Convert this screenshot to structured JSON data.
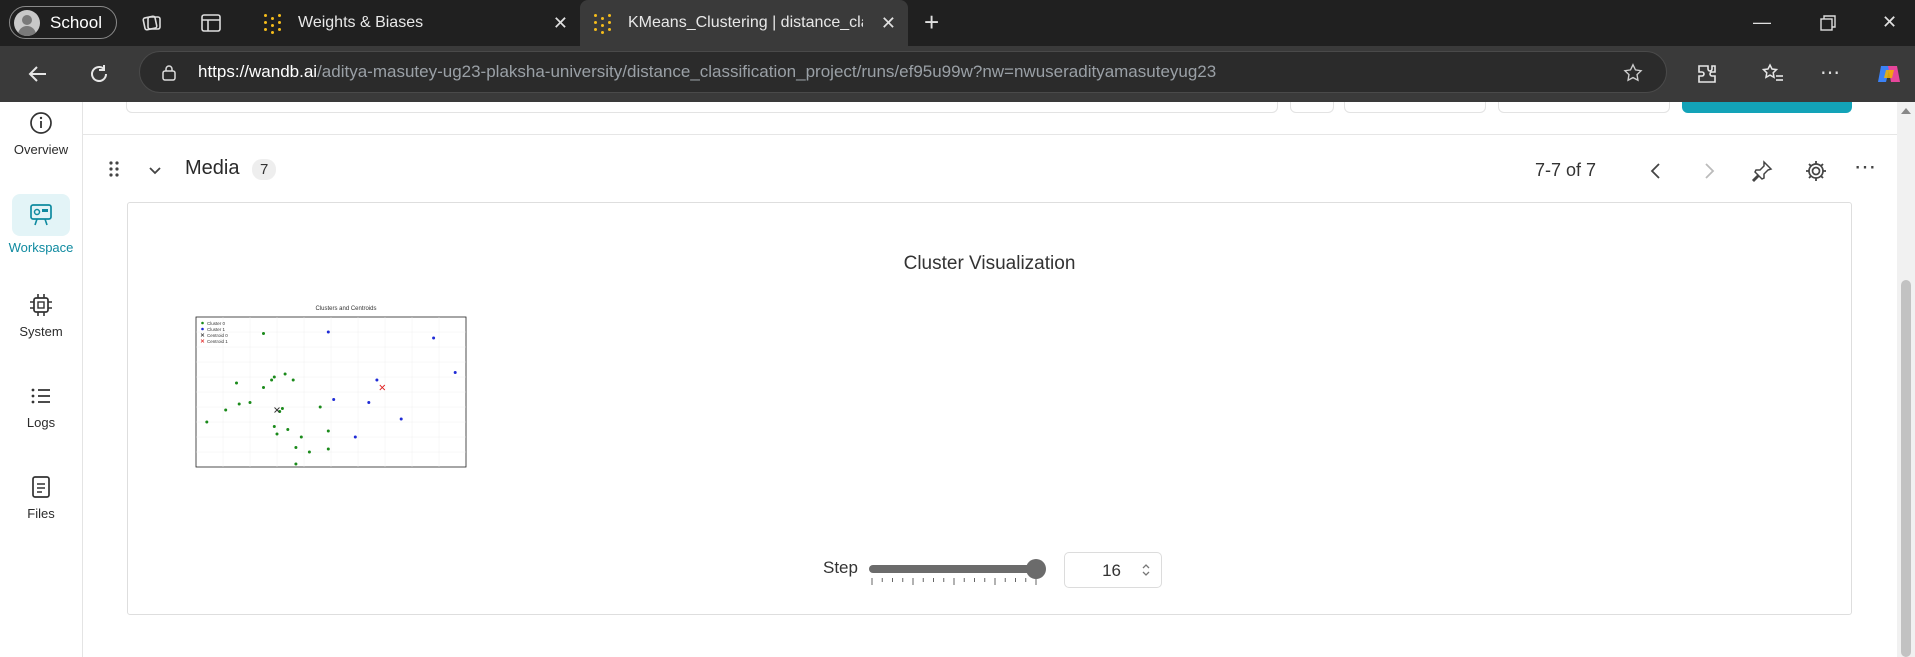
{
  "browser": {
    "profile_label": "School",
    "tabs": [
      {
        "title": "Weights & Biases",
        "active": false
      },
      {
        "title": "KMeans_Clustering | distance_clas",
        "active": true
      }
    ],
    "url_host": "https://wandb.ai",
    "url_path": "/aditya-masutey-ug23-plaksha-university/distance_classification_project/runs/ef95u99w?nw=nwuseradityamasuteyug23"
  },
  "sidebar": {
    "items": [
      {
        "label": "Overview",
        "icon": "info-icon",
        "active": false
      },
      {
        "label": "Workspace",
        "icon": "workspace-icon",
        "active": true
      },
      {
        "label": "System",
        "icon": "chip-icon",
        "active": false
      },
      {
        "label": "Logs",
        "icon": "list-icon",
        "active": false
      },
      {
        "label": "Files",
        "icon": "file-icon",
        "active": false
      }
    ],
    "active_color": "#0f8aa0"
  },
  "section": {
    "title": "Media",
    "count": "7",
    "pager": "7-7 of 7"
  },
  "panel": {
    "title": "Cluster Visualization",
    "step_label": "Step",
    "step_value": "16",
    "slider_fraction": 1.0
  },
  "chart_data": {
    "type": "scatter",
    "title": "Clusters and Centroids",
    "xlabel": "",
    "ylabel": "",
    "legend_position": "top-left",
    "legend": [
      "Cluster 0",
      "Cluster 1",
      "Centroid 0",
      "Centroid 1"
    ],
    "xlim": [
      0,
      10
    ],
    "ylim": [
      0,
      10
    ],
    "grid": true,
    "series": [
      {
        "name": "Cluster 0",
        "color": "#1a8a1a",
        "marker": "dot",
        "points": [
          [
            0.4,
            3.0
          ],
          [
            1.1,
            3.8
          ],
          [
            1.6,
            4.2
          ],
          [
            1.5,
            5.6
          ],
          [
            2.0,
            4.3
          ],
          [
            2.5,
            8.9
          ],
          [
            2.5,
            5.3
          ],
          [
            2.8,
            5.8
          ],
          [
            2.9,
            6.0
          ],
          [
            3.3,
            6.2
          ],
          [
            3.6,
            5.8
          ],
          [
            3.1,
            3.7
          ],
          [
            2.9,
            2.7
          ],
          [
            3.0,
            2.2
          ],
          [
            3.4,
            2.5
          ],
          [
            3.7,
            1.3
          ],
          [
            3.7,
            0.2
          ],
          [
            3.9,
            2.0
          ],
          [
            4.2,
            1.0
          ],
          [
            4.6,
            4.0
          ],
          [
            4.9,
            2.4
          ],
          [
            4.9,
            1.2
          ],
          [
            3.2,
            3.9
          ]
        ]
      },
      {
        "name": "Cluster 1",
        "color": "#1f2bd6",
        "marker": "dot",
        "points": [
          [
            4.9,
            9.0
          ],
          [
            5.1,
            4.5
          ],
          [
            5.9,
            2.0
          ],
          [
            6.4,
            4.3
          ],
          [
            6.7,
            5.8
          ],
          [
            7.6,
            3.2
          ],
          [
            8.8,
            8.6
          ],
          [
            9.6,
            6.3
          ]
        ]
      },
      {
        "name": "Centroid 0",
        "color": "#333333",
        "marker": "x",
        "points": [
          [
            3.0,
            3.8
          ]
        ]
      },
      {
        "name": "Centroid 1",
        "color": "#e02020",
        "marker": "x",
        "points": [
          [
            6.9,
            5.3
          ]
        ]
      }
    ]
  }
}
